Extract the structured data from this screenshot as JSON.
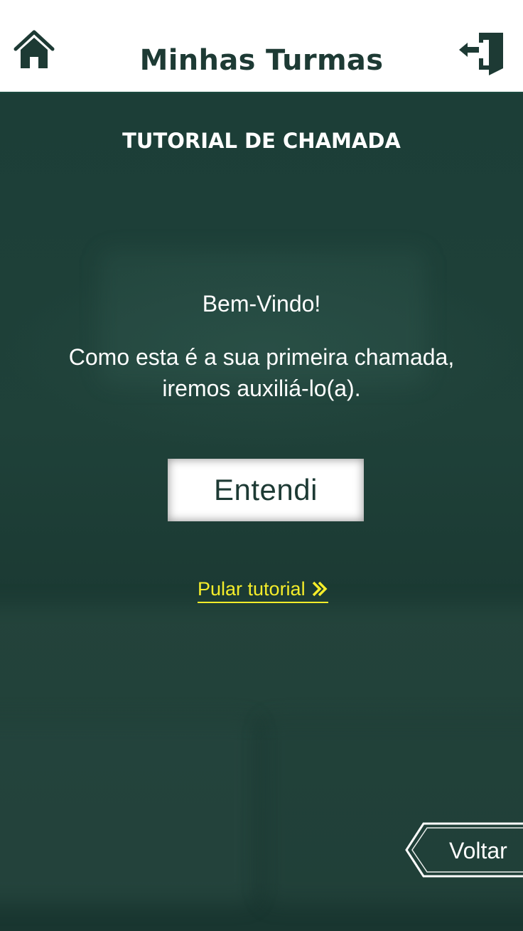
{
  "header": {
    "title": "Minhas Turmas",
    "home_icon": "home-icon",
    "exit_icon": "exit-door-icon"
  },
  "tutorial": {
    "title": "TUTORIAL DE CHAMADA",
    "welcome": "Bem-Vindo!",
    "message_line1": "Como esta é a sua primeira chamada,",
    "message_line2": "iremos auxiliá-lo(a).",
    "ok_label": "Entendi",
    "skip_label": "Pular tutorial",
    "skip_icon": "double-chevron-right-icon"
  },
  "footer": {
    "back_label": "Voltar"
  },
  "colors": {
    "brand_dark": "#1d3a34",
    "background": "#1d3f38",
    "link": "#f4ec2a"
  }
}
